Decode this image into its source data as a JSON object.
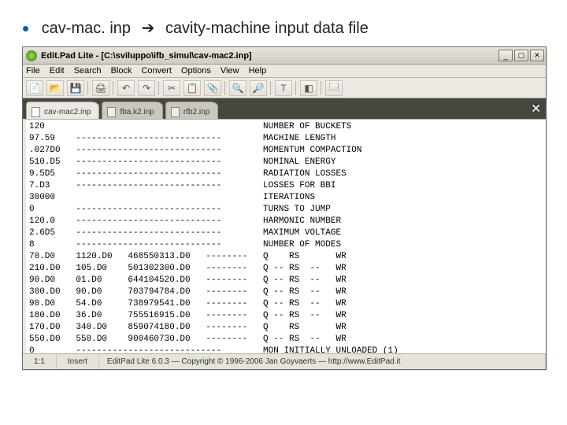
{
  "slide": {
    "filename": "cav-mac. inp",
    "arrow": "➔",
    "description": "cavity-machine input data file"
  },
  "titlebar": {
    "text": "Edit.Pad Lite - [C:\\sviluppo\\ifb_simul\\cav-mac2.inp]"
  },
  "win_buttons": {
    "min": "_",
    "max": "▢",
    "close": "✕"
  },
  "menu": [
    "File",
    "Edit",
    "Search",
    "Block",
    "Convert",
    "Options",
    "View",
    "Help"
  ],
  "toolbar_icons": [
    "📄",
    "📂",
    "💾",
    "│",
    "🖨",
    "│",
    "↶",
    "↷",
    "│",
    "✂",
    "📋",
    "📎",
    "│",
    "🔍",
    "🔎",
    "│",
    "T",
    "│",
    "◧",
    "│",
    "🗔"
  ],
  "tabs": [
    {
      "label": "cav-mac2.inp",
      "active": true
    },
    {
      "label": "fba.k2.inp",
      "active": false
    },
    {
      "label": "rfb2.inp",
      "active": false
    }
  ],
  "tab_close": "✕",
  "lines": [
    {
      "c1": "120",
      "c2": "",
      "c3": "",
      "c4": "",
      "desc": "NUMBER OF BUCKETS"
    },
    {
      "c1": "97.59",
      "c2": "----------------------------",
      "c3": "",
      "c4": "",
      "desc": "MACHINE LENGTH"
    },
    {
      "c1": ".027D0",
      "c2": "----------------------------",
      "c3": "",
      "c4": "",
      "desc": "MOMENTUM COMPACTION"
    },
    {
      "c1": "510.D5",
      "c2": "----------------------------",
      "c3": "",
      "c4": "",
      "desc": "NOMINAL ENERGY"
    },
    {
      "c1": "9.5D5",
      "c2": "----------------------------",
      "c3": "",
      "c4": "",
      "desc": "RADIATION LOSSES"
    },
    {
      "c1": "7.D3",
      "c2": "----------------------------",
      "c3": "",
      "c4": "",
      "desc": "LOSSES FOR BBI"
    },
    {
      "c1": "30000",
      "c2": "",
      "c3": "",
      "c4": "",
      "desc": "ITERATIONS"
    },
    {
      "c1": "0",
      "c2": "----------------------------",
      "c3": "",
      "c4": "",
      "desc": "TURNS TO JUMP"
    },
    {
      "c1": "120.0",
      "c2": "----------------------------",
      "c3": "",
      "c4": "",
      "desc": "HARMONIC NUMBER"
    },
    {
      "c1": "2.6D5",
      "c2": "----------------------------",
      "c3": "",
      "c4": "",
      "desc": "MAXIMUM VOLTAGE"
    },
    {
      "c1": "8",
      "c2": "----------------------------",
      "c3": "",
      "c4": "",
      "desc": "NUMBER OF MODES"
    },
    {
      "c1": "70.D0",
      "c2": "1120.D0",
      "c3": "468550313.D0",
      "c4": "--------",
      "desc": "Q    RS       WR"
    },
    {
      "c1": "210.D0",
      "c2": "105.D0",
      "c3": "501302300.D0",
      "c4": "--------",
      "desc": "Q -- RS  --   WR"
    },
    {
      "c1": "90.D0",
      "c2": "01.D0",
      "c3": "644104520.D0",
      "c4": "--------",
      "desc": "Q -- RS  --   WR"
    },
    {
      "c1": "300.D0",
      "c2": "90.D0",
      "c3": "703794784.D0",
      "c4": "--------",
      "desc": "Q -- RS  --   WR"
    },
    {
      "c1": "90.D0",
      "c2": "54.D0",
      "c3": "738979541.D0",
      "c4": "--------",
      "desc": "Q -- RS  --   WR"
    },
    {
      "c1": "180.D0",
      "c2": "36.D0",
      "c3": "755516915.D0",
      "c4": "--------",
      "desc": "Q -- RS  --   WR"
    },
    {
      "c1": "170.D0",
      "c2": "340.D0",
      "c3": "859074180.D0",
      "c4": "--------",
      "desc": "Q    RS       WR"
    },
    {
      "c1": "550.D0",
      "c2": "550.D0",
      "c3": "900460730.D0",
      "c4": "--------",
      "desc": "Q -- RS  --   WR"
    },
    {
      "c1": "0",
      "c2": "----------------------------",
      "c3": "",
      "c4": "",
      "desc": "MON INITIALLY UNLOADED (1)"
    }
  ],
  "status": {
    "pos": "1:1",
    "mode": "Insert",
    "msg": "EditPad Lite 6.0.3 — Copyright © 1996-2006 Jan Goyvaerts — http://www.EditPad.it"
  }
}
